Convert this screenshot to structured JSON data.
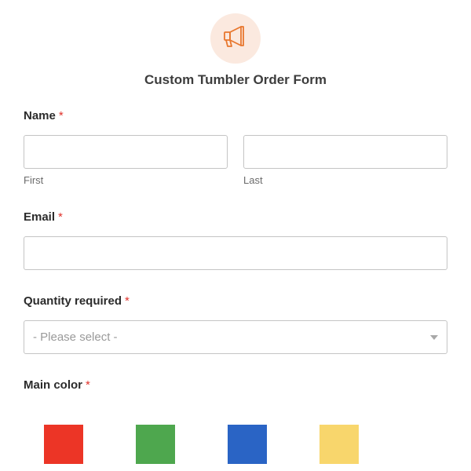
{
  "form": {
    "title": "Custom Tumbler Order Form",
    "logo_icon": "megaphone-icon",
    "accent_color": "#e8772e",
    "required_marker": "*"
  },
  "fields": {
    "name": {
      "label": "Name",
      "first_sublabel": "First",
      "last_sublabel": "Last",
      "first_value": "",
      "last_value": ""
    },
    "email": {
      "label": "Email",
      "value": ""
    },
    "quantity": {
      "label": "Quantity required",
      "selected": "- Please select -"
    },
    "main_color": {
      "label": "Main color",
      "options": [
        {
          "name": "red",
          "color": "#ec3526"
        },
        {
          "name": "green",
          "color": "#4ea74e"
        },
        {
          "name": "blue",
          "color": "#2a64c5"
        },
        {
          "name": "yellow",
          "color": "#f8d66c"
        }
      ]
    }
  }
}
